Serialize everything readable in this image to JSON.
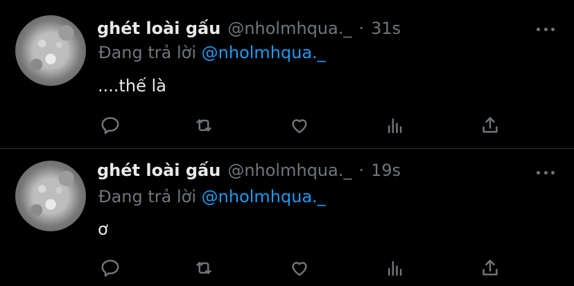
{
  "tweets": [
    {
      "display_name": "ghét loài gấu",
      "handle": "@nholmhqua._",
      "separator": "·",
      "time": "31s",
      "reply_prefix": "Đang trả lời",
      "reply_to": "@nholmhqua._",
      "text": "....thế là",
      "icons": [
        "reply-icon",
        "retweet-icon",
        "like-icon",
        "views-icon",
        "share-icon",
        "more-icon"
      ]
    },
    {
      "display_name": "ghét loài gấu",
      "handle": "@nholmhqua._",
      "separator": "·",
      "time": "19s",
      "reply_prefix": "Đang trả lời",
      "reply_to": "@nholmhqua._",
      "text": "ơ",
      "icons": [
        "reply-icon",
        "retweet-icon",
        "like-icon",
        "views-icon",
        "share-icon",
        "more-icon"
      ]
    }
  ],
  "colors": {
    "background": "#000000",
    "text_primary": "#e7e9ea",
    "text_secondary": "#71767b",
    "link": "#1d9bf0",
    "divider": "#2f3336"
  }
}
